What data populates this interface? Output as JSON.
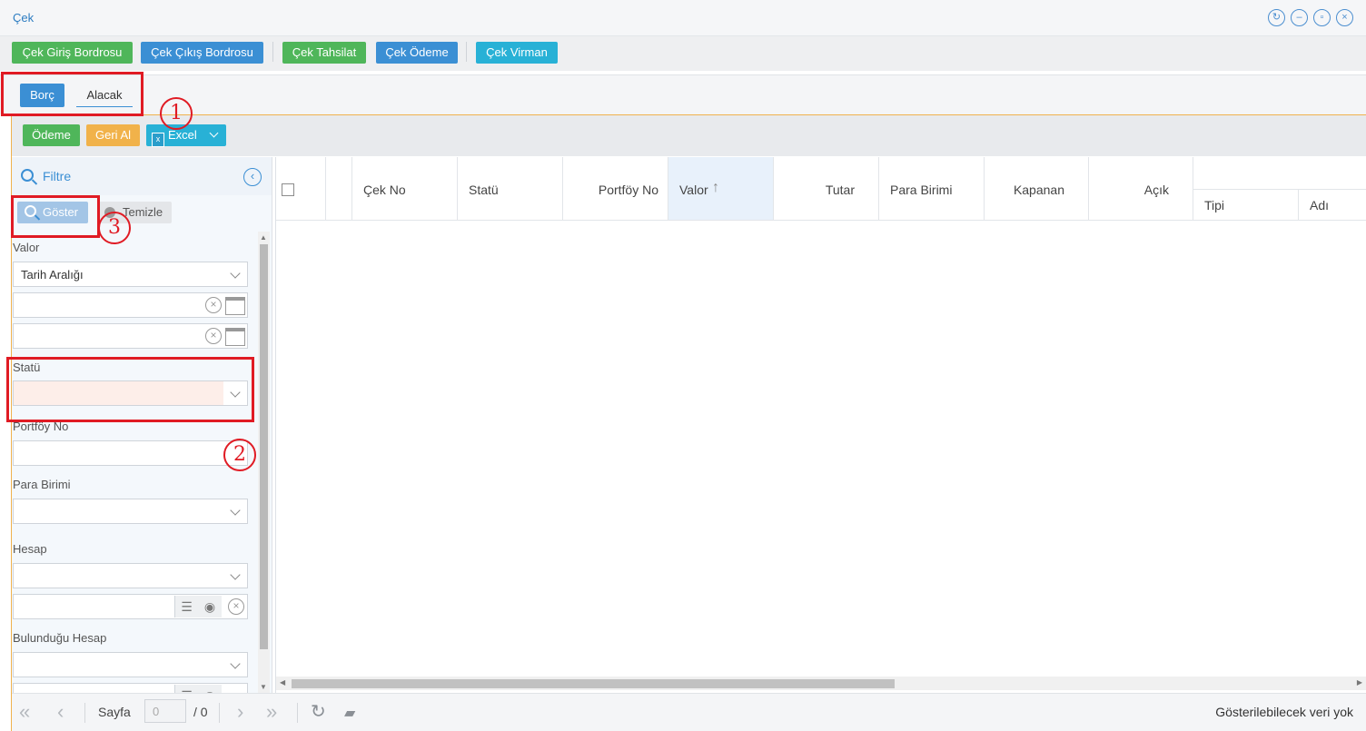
{
  "window": {
    "title": "Çek",
    "icons": [
      "refresh-icon",
      "minimize-icon",
      "restore-icon",
      "close-icon"
    ]
  },
  "toolbar": {
    "buttons": [
      {
        "label": "Çek Giriş Bordrosu",
        "color": "#4fb65a"
      },
      {
        "label": "Çek Çıkış Bordrosu",
        "color": "#3b8fd4"
      },
      {
        "label": "Çek Tahsilat",
        "color": "#4fb65a"
      },
      {
        "label": "Çek Ödeme",
        "color": "#3b8fd4"
      },
      {
        "label": "Çek Virman",
        "color": "#28b1d6"
      }
    ]
  },
  "tabs": [
    {
      "label": "Borç",
      "active": true
    },
    {
      "label": "Alacak",
      "active": false
    }
  ],
  "actions": {
    "odeme": "Ödeme",
    "geri_al": "Geri Al",
    "excel": "Excel",
    "excel_icon_glyph": "x"
  },
  "filter": {
    "title": "Filtre",
    "goster": "Göster",
    "temizle": "Temizle",
    "valor_label": "Valor",
    "valor_mode": "Tarih Aralığı",
    "statu_label": "Statü",
    "portfoy_label": "Portföy No",
    "para_birimi_label": "Para Birimi",
    "hesap_label": "Hesap",
    "bulundugu_hesap_label": "Bulunduğu Hesap"
  },
  "grid": {
    "columns": [
      "Çek No",
      "Statü",
      "Portföy No",
      "Valor",
      "Tutar",
      "Para Birimi",
      "Kapanan",
      "Açık"
    ],
    "sorted_column": "Valor",
    "sort_direction": "ascending",
    "sub_columns": [
      "Tipi",
      "Adı"
    ],
    "rows": []
  },
  "pager": {
    "page_label": "Sayfa",
    "page_value": "0",
    "total": "/ 0",
    "status": "Gösterilebilecek veri yok"
  },
  "annotations": [
    "1",
    "2",
    "3"
  ],
  "colors": {
    "accent_blue": "#3b8fd4",
    "green": "#4fb65a",
    "orange": "#f1b24a",
    "annotation_red": "#e01b24"
  }
}
